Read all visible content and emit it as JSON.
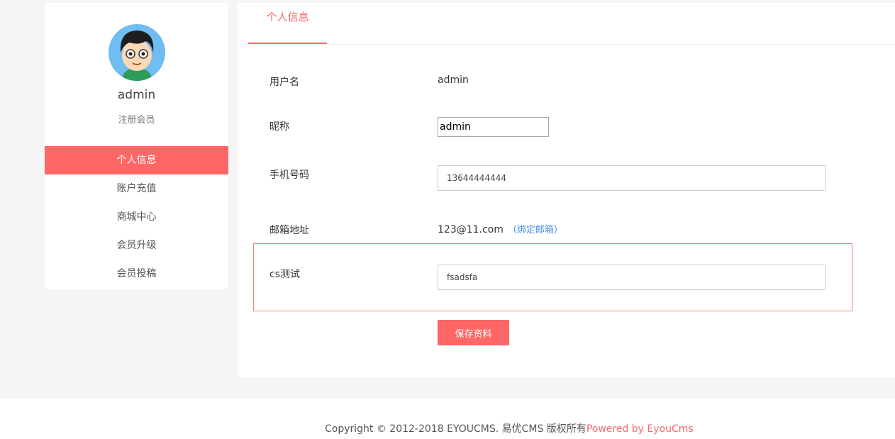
{
  "sidebar": {
    "username": "admin",
    "level": "注册会员",
    "menu": [
      {
        "label": "个人信息",
        "active": true
      },
      {
        "label": "账户充值",
        "active": false
      },
      {
        "label": "商城中心",
        "active": false
      },
      {
        "label": "会员升级",
        "active": false
      },
      {
        "label": "会员投稿",
        "active": false
      }
    ]
  },
  "main": {
    "tab_label": "个人信息",
    "fields": {
      "username_label": "用户名",
      "username_value": "admin",
      "nickname_label": "昵称",
      "nickname_value": "admin",
      "mobile_label": "手机号码",
      "mobile_value": "13644444444",
      "email_label": "邮箱地址",
      "email_value": "123@11.com",
      "email_bind_link": "（绑定邮箱）",
      "cs_label": "cs测试",
      "cs_value": "fsadsfa"
    },
    "save_button": "保存资料"
  },
  "footer": {
    "copyright": "Copyright © 2012-2018 EYOUCMS. 易优CMS 版权所有",
    "powered": "Powered by EyouCms"
  },
  "colors": {
    "accent": "#ff6666",
    "link": "#4a90e2",
    "avatar_bg": "#6fbdf2"
  }
}
